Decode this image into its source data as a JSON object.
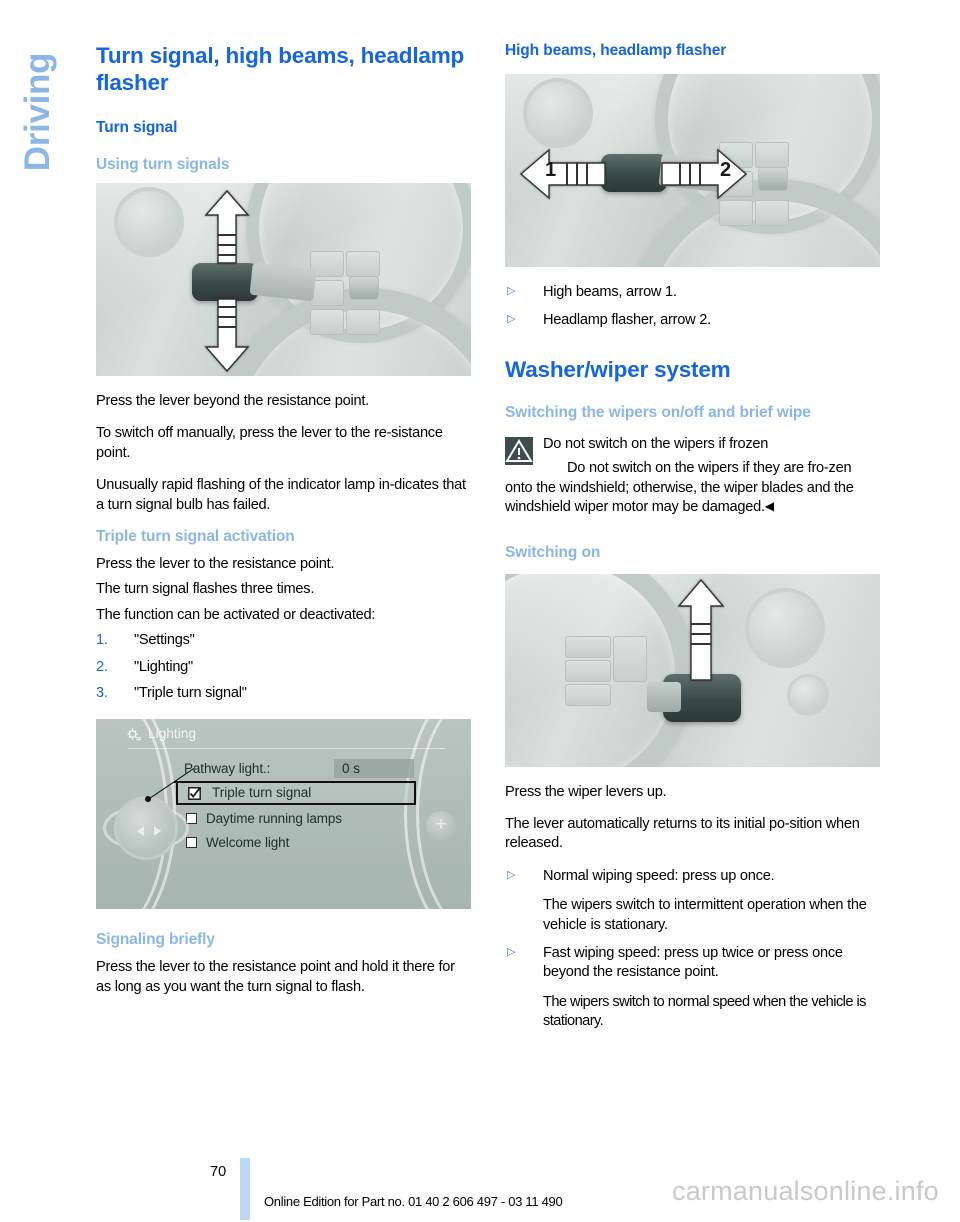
{
  "sidebar": {
    "chapter_label": "Driving"
  },
  "left_column": {
    "title": "Turn signal, high beams, headlamp flasher",
    "section_turn_signal": "Turn signal",
    "sub_using": "Using turn signals",
    "figure_turn_signal_alt": "steering-column-lever-up-down",
    "para_1": "Press the lever beyond the resistance point.",
    "para_2": "To switch off manually, press the lever to the re‐sistance point.",
    "para_3": "Unusually rapid flashing of the indicator lamp in‐dicates that a turn signal bulb has failed.",
    "sub_triple": "Triple turn signal activation",
    "para_4": "Press the lever to the resistance point.",
    "para_5": "The turn signal flashes three times.",
    "para_6": "The function can be activated or deactivated:",
    "steps": [
      {
        "num": "1.",
        "text": "\"Settings\""
      },
      {
        "num": "2.",
        "text": "\"Lighting\""
      },
      {
        "num": "3.",
        "text": "\"Triple turn signal\""
      }
    ],
    "idrive": {
      "title": "Lighting",
      "gear_icon": "gear-icon",
      "rows": [
        {
          "label": "Pathway light.:",
          "value": "0 s",
          "type": "value"
        },
        {
          "label": "Triple turn signal",
          "type": "checkbox",
          "checked": true,
          "highlighted": true
        },
        {
          "label": "Daytime running lamps",
          "type": "checkbox",
          "checked": false
        },
        {
          "label": "Welcome light",
          "type": "checkbox",
          "checked": false
        }
      ],
      "controller_icon": "idrive-controller-knob",
      "plus_icon": "plus-icon"
    },
    "sub_signaling": "Signaling briefly",
    "para_7": "Press the lever to the resistance point and hold it there for as long as you want the turn signal to flash."
  },
  "right_column": {
    "section_high_beams": "High beams, headlamp flasher",
    "figure_high_beams_alt": "steering-column-lever-left-right",
    "figure_labels": {
      "label_1": "1",
      "label_2": "2"
    },
    "bullets_high_beams": [
      "High beams, arrow 1.",
      "Headlamp flasher, arrow 2."
    ],
    "section_washer": "Washer/wiper system",
    "sub_switching_wipers": "Switching the wipers on/off and brief wipe",
    "warning": {
      "icon": "warning-triangle-icon",
      "headline": "Do not switch on the wipers if frozen",
      "body": "Do not switch on the wipers if they are fro‐zen onto the windshield; otherwise, the wiper blades and the windshield wiper motor may be damaged.",
      "end_marker": "◀"
    },
    "sub_switching_on": "Switching on",
    "figure_switching_on_alt": "wiper-lever-press-up",
    "para_1": "Press the wiper levers up.",
    "para_2": "The lever automatically returns to its initial po‐sition when released.",
    "bullets_wipers": [
      {
        "main": "Normal wiping speed: press up once.",
        "sub": "The wipers switch to intermittent operation when the vehicle is stationary."
      },
      {
        "main": "Fast wiping speed: press up twice or press once beyond the resistance point.",
        "sub": "The wipers switch to normal speed when the vehicle is stationary."
      }
    ]
  },
  "footer": {
    "page_number": "70",
    "edition_text": "Online Edition for Part no. 01 40 2 606 497 - 03 11 490",
    "watermark": "carmanualsonline.info"
  },
  "colors": {
    "heading_blue": "#1565e0",
    "subheading_blue": "#8ab6e8",
    "tab_blue": "#8ab6e8",
    "bullet_blue": "#3b7ddd",
    "warning_bg": "#3d4c4c",
    "page_bar": "#bcd7f0",
    "watermark_gray": "#c9c9c9"
  }
}
